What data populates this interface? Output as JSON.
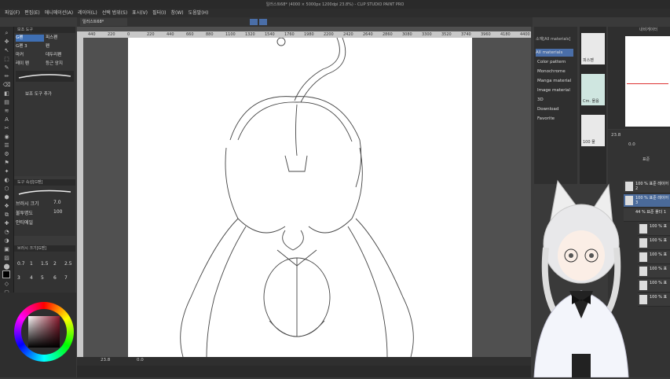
{
  "window": {
    "title": "일러스트68* (4000 × 5000px 1200dpi 23.8%) - CLIP STUDIO PAINT PRO"
  },
  "menu": [
    "파일(F)",
    "편집(E)",
    "애니메이션(A)",
    "레이어(L)",
    "선택 범위(S)",
    "표시(V)",
    "필터(I)",
    "창(W)",
    "도움말(H)"
  ],
  "canvas_tab": "일러스트68*",
  "subtool": {
    "items": [
      "G펜",
      "피스펜",
      "G펜 3",
      "펜",
      "마커",
      "데두리펜",
      "레이 펜",
      "등근 앙지"
    ],
    "add_button": "보조 도구 추가"
  },
  "tool_property": {
    "header": "도구 속성[G펜]",
    "brush_size_label": "브러시 크기",
    "brush_size_value": "7.0",
    "opacity_label": "불투명도",
    "opacity_value": "100",
    "antialias_label": "안티에일"
  },
  "brush_size_panel": {
    "header": "브러시 크기[G펜]",
    "sizes": [
      "0.7",
      "1",
      "1.5",
      "2",
      "2.5",
      "3",
      "4",
      "5",
      "6",
      "7"
    ]
  },
  "color": {
    "accent": "#8b1a2e",
    "fg": "#000000",
    "bg": "#ffffff"
  },
  "ruler": {
    "marks": [
      "440",
      "220",
      "0",
      "220",
      "440",
      "660",
      "880",
      "1100",
      "1320",
      "1540",
      "1760",
      "1980",
      "2200",
      "2420",
      "2640",
      "2860",
      "3080",
      "3300",
      "3520",
      "3740",
      "3960",
      "4180",
      "4400"
    ]
  },
  "status": {
    "zoom": "23.8",
    "angle": "0.0"
  },
  "materials": {
    "header": "소재[All materials]",
    "items": [
      "All materials",
      "Color pattern",
      "Monochrome",
      "Manga material",
      "Image material",
      "3D",
      "Download",
      "Favorite"
    ]
  },
  "thumbs": [
    "피스펜",
    "Cm. 물음",
    "100 물"
  ],
  "navigator": {
    "header": "내비게이터",
    "zoom": "23.8",
    "angle": "0.0"
  },
  "layers": {
    "header": "레이어",
    "blend": "표준",
    "opacity": "100",
    "items": [
      "100 % 표준 레이어 2",
      "100 % 표준 레이어 3",
      "44 % 표준 폴더 1",
      "100 % 표",
      "100 % 표",
      "100 % 표",
      "100 % 표",
      "100 % 표",
      "100 % 표"
    ]
  }
}
